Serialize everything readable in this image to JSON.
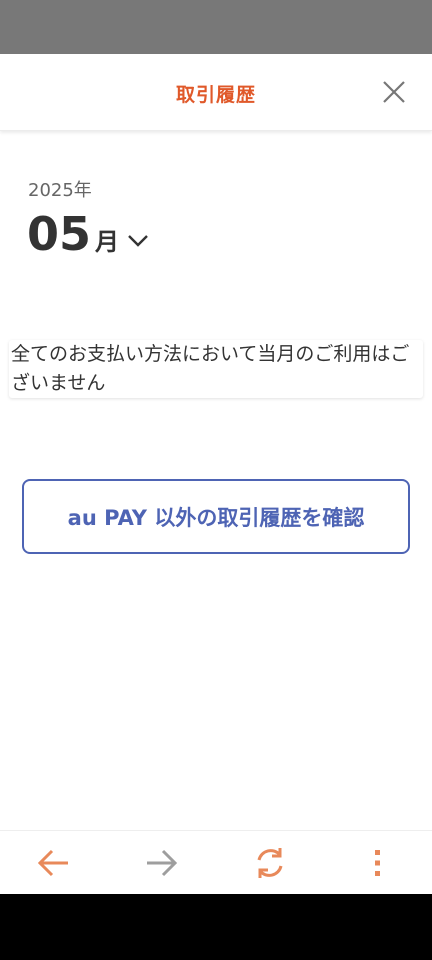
{
  "header": {
    "title": "取引履歴",
    "close_icon": "close-icon"
  },
  "period": {
    "year_label": "2025年",
    "month_number": "05",
    "month_unit": "月"
  },
  "notice": {
    "message": "全てのお支払い方法において当月のご利用はございません"
  },
  "other_history_button": {
    "label": "au PAY 以外の取引履歴を確認"
  },
  "browser_toolbar": {
    "icons": [
      "back-arrow-icon",
      "forward-arrow-icon",
      "refresh-icon",
      "more-vertical-icon"
    ]
  },
  "colors": {
    "accent_orange": "#e0592a",
    "toolbar_orange": "#e8895a",
    "button_blue": "#4e64b4",
    "disabled_gray": "#9e9e9e",
    "status_bar": "#787878"
  }
}
